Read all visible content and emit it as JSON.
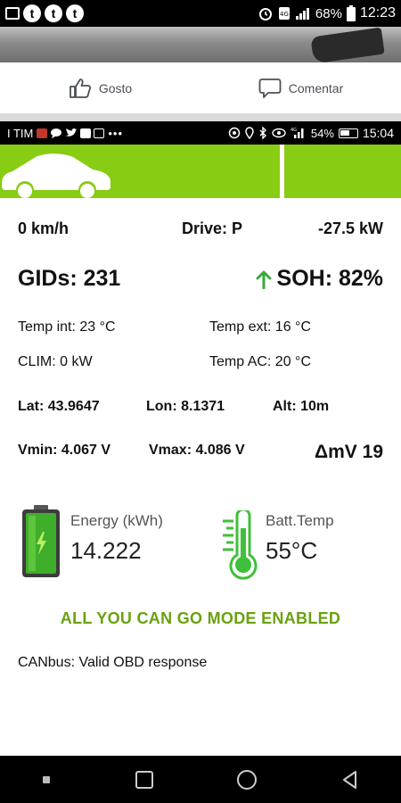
{
  "outer_status": {
    "battery_pct": "68%",
    "time": "12:23"
  },
  "facebook": {
    "like_label": "Gosto",
    "comment_label": "Comentar"
  },
  "inner_status": {
    "carrier": "I TIM",
    "battery_pct": "54%",
    "time": "15:04"
  },
  "app": {
    "speed": "0 km/h",
    "drive": "Drive: P",
    "power": "-27.5 kW",
    "gids": "GIDs: 231",
    "soh": "SOH: 82%",
    "temp_int": "Temp int: 23 °C",
    "temp_ext": "Temp ext: 16 °C",
    "clim": "CLIM: 0 kW",
    "temp_ac": "Temp AC: 20 °C",
    "lat": "Lat: 43.9647",
    "lon": "Lon: 8.1371",
    "alt": "Alt: 10m",
    "vmin": "Vmin: 4.067 V",
    "vmax": "Vmax: 4.086 V",
    "dmv": "ΔmV 19",
    "energy_label": "Energy (kWh)",
    "energy_value": "14.222",
    "batt_temp_label": "Batt.Temp",
    "batt_temp_value": "55°C",
    "mode_banner": "ALL YOU CAN GO MODE ENABLED",
    "canbus_status": "CANbus: Valid OBD response"
  },
  "colors": {
    "accent_green": "#88cc13",
    "banner_green": "#6aa10f",
    "arrow_green": "#3aa83a"
  }
}
